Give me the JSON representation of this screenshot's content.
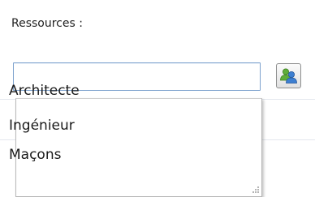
{
  "resources": {
    "label": "Ressources :",
    "input_value": "",
    "input_placeholder": "",
    "button_icon": "users-icon",
    "suggestions": [
      {
        "label": "Architecte"
      },
      {
        "label": "Ingénieur"
      },
      {
        "label": "Maçons"
      }
    ]
  },
  "colors": {
    "input_border": "#7da2ce",
    "icon_green": "#4e9a2f",
    "icon_blue": "#2f6fbf"
  }
}
